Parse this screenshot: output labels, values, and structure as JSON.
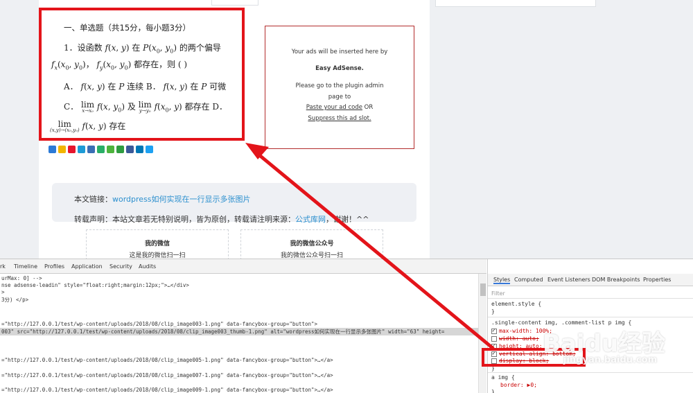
{
  "quiz": {
    "title": "一、单选题（共15分，每小题3分）",
    "q1_text_a": "1．设函数",
    "q1_text_b": "在",
    "q1_text_c": "的两个偏导",
    "q1_text_d": "都存在，则 ( )",
    "optA_label": "A．",
    "optA_text": "在",
    "optA_text2": "连续 B．",
    "optA_text3": "在",
    "optA_text4": "可微",
    "optC_label": "C．",
    "optC_text": "及",
    "optC_text2": "都存在 D．",
    "optD_text": "存在"
  },
  "ad": {
    "line1": "Your ads will be inserted here by",
    "line2": "Easy AdSense.",
    "line3": "Please go to the plugin admin",
    "line4": "page to",
    "line5": "Paste your ad code",
    "line5b": "OR",
    "line6": "Suppress this ad slot."
  },
  "article_footer": {
    "link_prefix": "本文链接：",
    "link_text": "wordpress如何实现在一行显示多张图片",
    "copyright_prefix": "转载声明：本站文章若无特别说明，皆为原创，转载请注明来源：",
    "copyright_link": "公式库网",
    "copyright_suffix": "，谢谢！^^"
  },
  "wechat": {
    "left_title": "我的微信",
    "left_sub": "这是我的微信扫一扫",
    "right_title": "我的微信公众号",
    "right_sub": "我的微信公众号扫一扫"
  },
  "devtools": {
    "tabs": [
      "rk",
      "Timeline",
      "Profiles",
      "Application",
      "Security",
      "Audits"
    ],
    "lines": [
      "urMax: 0] -->",
      "nse adsense-leadin\" style=\"float:right;margin:12px;\">…</div>",
      ">",
      "3分) </p>",
      "=\"http://127.0.0.1/test/wp-content/uploads/2018/08/clip_image003-1.png\" data-fancybox-group=\"button\">",
      "003\" src=\"http://127.0.0.1/test/wp-content/uploads/2018/08/clip_image003_thumb-1.png\" alt=\"wordpress如何实现在一行显示多张图片\" width=\"63\" height=",
      "=\"http://127.0.0.1/test/wp-content/uploads/2018/08/clip_image005-1.png\" data-fancybox-group=\"button\">…</a>",
      "=\"http://127.0.0.1/test/wp-content/uploads/2018/08/clip_image007-1.png\" data-fancybox-group=\"button\">…</a>",
      "=\"http://127.0.0.1/test/wp-content/uploads/2018/08/clip_image009-1.png\" data-fancybox-group=\"button\">…</a>"
    ],
    "styles_tabs": [
      "Styles",
      "Computed",
      "Event Listeners",
      "DOM Breakpoints",
      "Properties"
    ],
    "filter_placeholder": "Filter",
    "element_style": "element.style {",
    "close_brace": "}",
    "rule_selector": ".single-content img, .comment-list p img {",
    "prop_maxwidth": "max-width: 100%;",
    "prop_width": "width: auto;",
    "prop_height": "height: auto;",
    "prop_vertical": "vertical-align: bottom;",
    "prop_display": "display: block;",
    "rule2_selector": "a img {",
    "prop_border": "border: ▶0;"
  },
  "watermark": {
    "logo": "Baidu经验",
    "sub": "jingyan.baidu.com"
  },
  "colors": {
    "annotation_red": "#e3141a",
    "link_blue": "#2b8fce"
  }
}
